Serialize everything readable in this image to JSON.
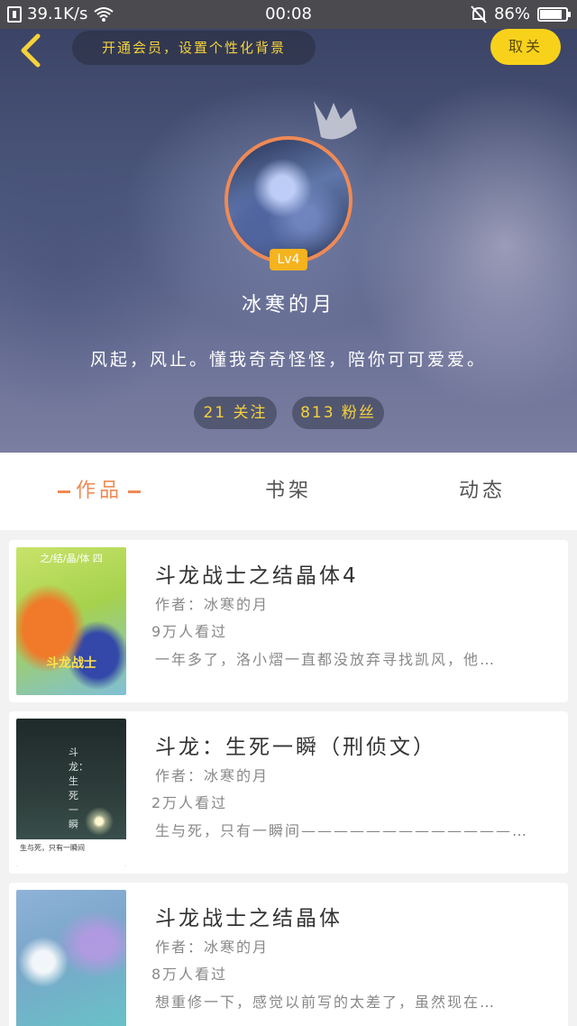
{
  "status_bar": {
    "network_speed": "39.1K/s",
    "time": "00:08",
    "battery": "86%",
    "battery_level": 0.86
  },
  "header": {
    "vip_banner": "开通会员，设置个性化背景",
    "close_label": "取关",
    "level": "Lv4",
    "nickname": "冰寒的月",
    "signature": "风起，风止。懂我奇奇怪怪，陪你可可爱爱。",
    "following": "21 关注",
    "fans": "813 粉丝"
  },
  "tabs": [
    {
      "label": "作品",
      "active": true
    },
    {
      "label": "书架",
      "active": false
    },
    {
      "label": "动态",
      "active": false
    }
  ],
  "books": [
    {
      "title": "斗龙战士之结晶体4",
      "author": "作者：冰寒的月",
      "views": "9万人看过",
      "desc": "一年多了，洛小熠一直都没放弃寻找凯风，他…",
      "cover_top": "之/结/晶/体 四",
      "cover_text": "斗龙战士"
    },
    {
      "title": "斗龙：生死一瞬（刑侦文）",
      "author": "作者：冰寒的月",
      "views": "2万人看过",
      "desc": "生与死，只有一瞬间—————————————…",
      "cover_vert": "斗龙：生死一瞬",
      "cover_bottom": "生与死，只有一瞬间"
    },
    {
      "title": "斗龙战士之结晶体",
      "author": "作者：冰寒的月",
      "views": "8万人看过",
      "desc": "想重修一下，感觉以前写的太差了，虽然现在…"
    }
  ],
  "colors": {
    "accent": "#ef8a55",
    "yellow": "#f8d21a"
  }
}
